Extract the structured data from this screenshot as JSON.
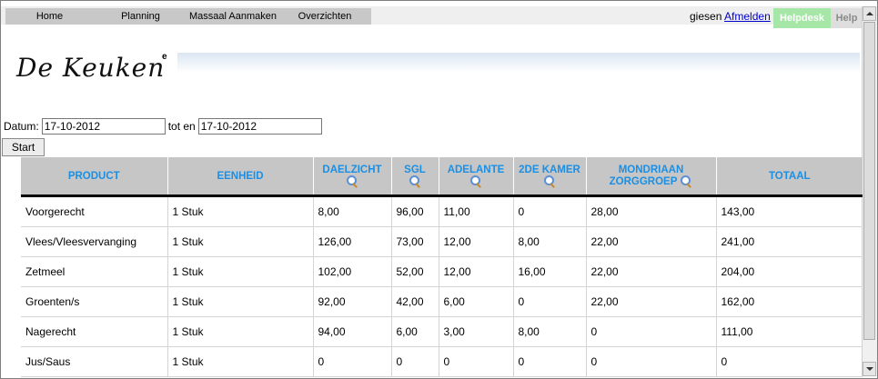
{
  "menu": [
    {
      "label": "Home"
    },
    {
      "label": "Planning"
    },
    {
      "label": "Massaal Aanmaken"
    },
    {
      "label": "Overzichten"
    }
  ],
  "user": {
    "name": "giesen",
    "logout_label": "Afmelden"
  },
  "helpdesk_label": "Helpdesk",
  "help_label": "Help",
  "logo": {
    "text": "De Keuken",
    "mark": "e"
  },
  "filter": {
    "date_label": "Datum:",
    "date_from": "17-10-2012",
    "to_label": "tot en",
    "date_to": "17-10-2012",
    "start_label": "Start"
  },
  "table": {
    "columns": [
      {
        "label": "PRODUCT",
        "icon": ""
      },
      {
        "label": "EENHEID",
        "icon": ""
      },
      {
        "label": "DAELZICHT",
        "icon": "magnifier-icon"
      },
      {
        "label": "SGL",
        "icon": "magnifier-icon"
      },
      {
        "label": "ADELANTE",
        "icon": "magnifier-icon"
      },
      {
        "label": "2DE KAMER",
        "icon": "magnifier-icon"
      },
      {
        "label": "MONDRIAAN ZORGGROEP",
        "icon": "magnifier-icon"
      },
      {
        "label": "TOTAAL",
        "icon": ""
      }
    ],
    "rows": [
      [
        "Voorgerecht",
        "1 Stuk",
        "8,00",
        "96,00",
        "11,00",
        "0",
        "28,00",
        "143,00"
      ],
      [
        "Vlees/Vleesvervanging",
        "1 Stuk",
        "126,00",
        "73,00",
        "12,00",
        "8,00",
        "22,00",
        "241,00"
      ],
      [
        "Zetmeel",
        "1 Stuk",
        "102,00",
        "52,00",
        "12,00",
        "16,00",
        "22,00",
        "204,00"
      ],
      [
        "Groenten/s",
        "1 Stuk",
        "92,00",
        "42,00",
        "6,00",
        "0",
        "22,00",
        "162,00"
      ],
      [
        "Nagerecht",
        "1 Stuk",
        "94,00",
        "6,00",
        "3,00",
        "8,00",
        "0",
        "111,00"
      ],
      [
        "Jus/Saus",
        "1 Stuk",
        "0",
        "0",
        "0",
        "0",
        "0",
        "0"
      ]
    ]
  },
  "colors": {
    "header_text": "#1a8fe6",
    "header_bg": "#c6c6c6",
    "helpdesk_bg": "#a6e6a6",
    "link": "#0000cc"
  }
}
